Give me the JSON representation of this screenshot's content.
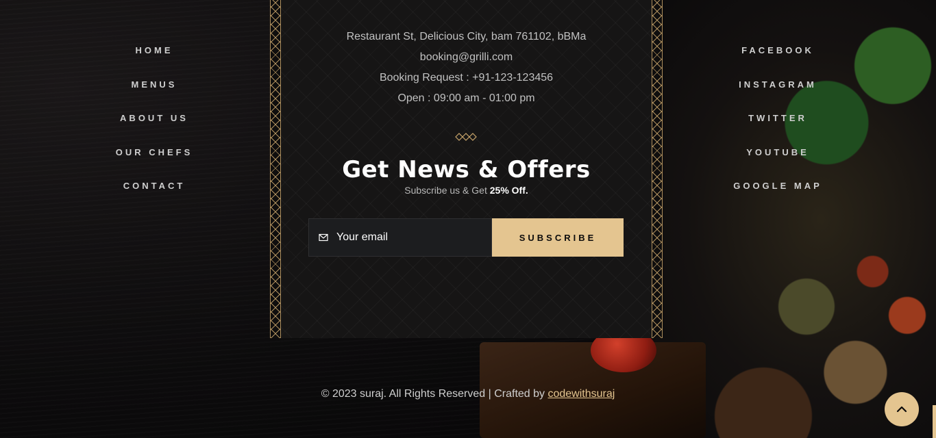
{
  "nav_left": [
    {
      "label": "HOME"
    },
    {
      "label": "MENUS"
    },
    {
      "label": "ABOUT US"
    },
    {
      "label": "OUR CHEFS"
    },
    {
      "label": "CONTACT"
    }
  ],
  "nav_right": [
    {
      "label": "FACEBOOK"
    },
    {
      "label": "INSTAGRAM"
    },
    {
      "label": "TWITTER"
    },
    {
      "label": "YOUTUBE"
    },
    {
      "label": "GOOGLE MAP"
    }
  ],
  "info": {
    "address": "Restaurant St, Delicious City, bam 761102, bBMa",
    "email": "booking@grilli.com",
    "booking": "Booking Request : +91-123-123456",
    "hours": "Open : 09:00 am - 01:00 pm"
  },
  "newsletter": {
    "title": "Get News & Offers",
    "subtitle_prefix": "Subscribe us & Get ",
    "subtitle_highlight": "25% Off.",
    "email_placeholder": "Your email",
    "button_label": "SUBSCRIBE"
  },
  "footer": {
    "copyright_text": "© 2023 suraj. All Rights Reserved | Crafted by ",
    "author_link": "codewithsuraj"
  },
  "colors": {
    "accent": "#e4c590",
    "background": "#0b0a0b",
    "card": "#161515"
  },
  "icons": {
    "mail": "mail-icon",
    "back_to_top": "chevron-up-icon"
  }
}
